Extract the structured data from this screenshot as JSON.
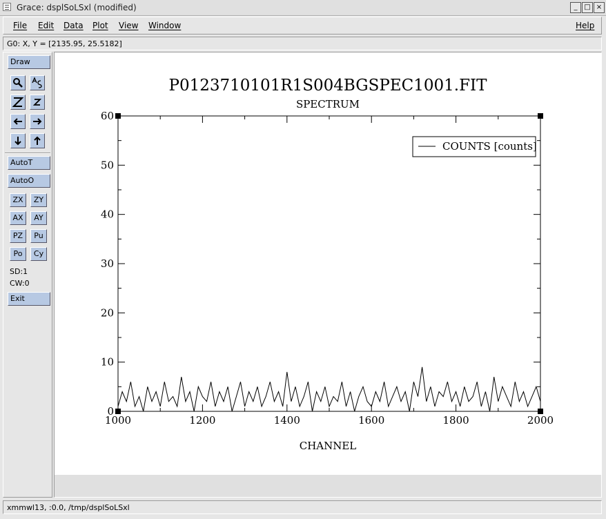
{
  "window": {
    "title": "Grace: dsplSoLSxl (modified)",
    "controls": {
      "minimize": "_",
      "maximize": "□",
      "close": "×"
    }
  },
  "menubar": {
    "items": [
      "File",
      "Edit",
      "Data",
      "Plot",
      "View",
      "Window"
    ],
    "help": "Help"
  },
  "locator": "G0: X, Y = [2135.95, 25.5182]",
  "toolbar": {
    "draw": "Draw",
    "autot": "AutoT",
    "autoo": "AutoO",
    "zx": "ZX",
    "zy": "ZY",
    "ax": "AX",
    "ay": "AY",
    "pz": "PZ",
    "pu": "Pu",
    "po": "Po",
    "cy": "Cy",
    "sd": "SD:1",
    "cw": "CW:0",
    "exit": "Exit",
    "icons": [
      "zoom-icon",
      "autoscale-icon",
      "zoom-x-icon",
      "zoom-y-icon",
      "left-arrow-icon",
      "right-arrow-icon",
      "down-arrow-icon",
      "up-arrow-icon"
    ]
  },
  "statusbar": "xmmwl13, :0.0, /tmp/dsplSoLSxl",
  "chart_data": {
    "type": "line",
    "title": "P0123710101R1S004BGSPEC1001.FIT",
    "subtitle": "SPECTRUM",
    "xlabel": "CHANNEL",
    "ylabel": "",
    "xlim": [
      1000,
      2000
    ],
    "ylim": [
      0,
      60
    ],
    "xticks": [
      "1000",
      "1200",
      "1400",
      "1600",
      "1800",
      "2000"
    ],
    "yticks": [
      "0",
      "10",
      "20",
      "30",
      "40",
      "50",
      "60"
    ],
    "legend_position": "top-right",
    "grid": false,
    "series": [
      {
        "name": "COUNTS [counts]",
        "color": "#000000",
        "x": [
          1000,
          1010,
          1020,
          1030,
          1040,
          1050,
          1060,
          1070,
          1080,
          1090,
          1100,
          1110,
          1120,
          1130,
          1140,
          1150,
          1160,
          1170,
          1180,
          1190,
          1200,
          1210,
          1220,
          1230,
          1240,
          1250,
          1260,
          1270,
          1280,
          1290,
          1300,
          1310,
          1320,
          1330,
          1340,
          1350,
          1360,
          1370,
          1380,
          1390,
          1400,
          1410,
          1420,
          1430,
          1440,
          1450,
          1460,
          1470,
          1480,
          1490,
          1500,
          1510,
          1520,
          1530,
          1540,
          1550,
          1560,
          1570,
          1580,
          1590,
          1600,
          1610,
          1620,
          1630,
          1640,
          1650,
          1660,
          1670,
          1680,
          1690,
          1700,
          1710,
          1720,
          1730,
          1740,
          1750,
          1760,
          1770,
          1780,
          1790,
          1800,
          1810,
          1820,
          1830,
          1840,
          1850,
          1860,
          1870,
          1880,
          1890,
          1900,
          1910,
          1920,
          1930,
          1940,
          1950,
          1960,
          1970,
          1980,
          1990,
          2000
        ],
        "y": [
          1,
          4,
          2,
          6,
          1,
          3,
          0,
          5,
          2,
          4,
          1,
          6,
          2,
          3,
          1,
          7,
          2,
          4,
          0,
          5,
          3,
          2,
          6,
          1,
          4,
          2,
          5,
          0,
          3,
          6,
          1,
          4,
          2,
          5,
          1,
          3,
          6,
          2,
          4,
          1,
          8,
          2,
          5,
          1,
          3,
          6,
          0,
          4,
          2,
          5,
          1,
          3,
          2,
          6,
          1,
          4,
          0,
          3,
          5,
          2,
          1,
          4,
          2,
          6,
          1,
          3,
          5,
          2,
          4,
          0,
          6,
          3,
          9,
          2,
          5,
          1,
          4,
          3,
          6,
          2,
          4,
          1,
          5,
          2,
          3,
          6,
          1,
          4,
          0,
          7,
          2,
          5,
          3,
          1,
          6,
          2,
          4,
          1,
          3,
          5,
          2
        ]
      }
    ]
  }
}
